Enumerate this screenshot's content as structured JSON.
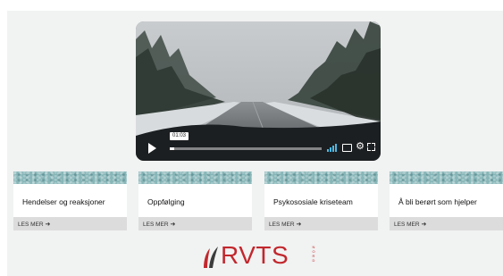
{
  "video": {
    "time_label": "01:03",
    "progress": 0.03,
    "icons": [
      "play-icon",
      "volume-icon",
      "captions-icon",
      "gear-icon",
      "fullscreen-icon"
    ]
  },
  "cards": [
    {
      "title": "Hendelser og reaksjoner",
      "link": "LES MER"
    },
    {
      "title": "Oppfølging",
      "link": "LES MER"
    },
    {
      "title": "Psykososiale kriseteam",
      "link": "LES MER"
    },
    {
      "title": "Å bli berørt som hjelper",
      "link": "LES MER"
    }
  ],
  "logo": {
    "text": "RVTS",
    "subtext": "NORD",
    "color": "#c2272d"
  },
  "colors": {
    "card_band": "#87b6b8",
    "background": "#f1f2f2",
    "volume_accent": "#4fb8e3"
  }
}
